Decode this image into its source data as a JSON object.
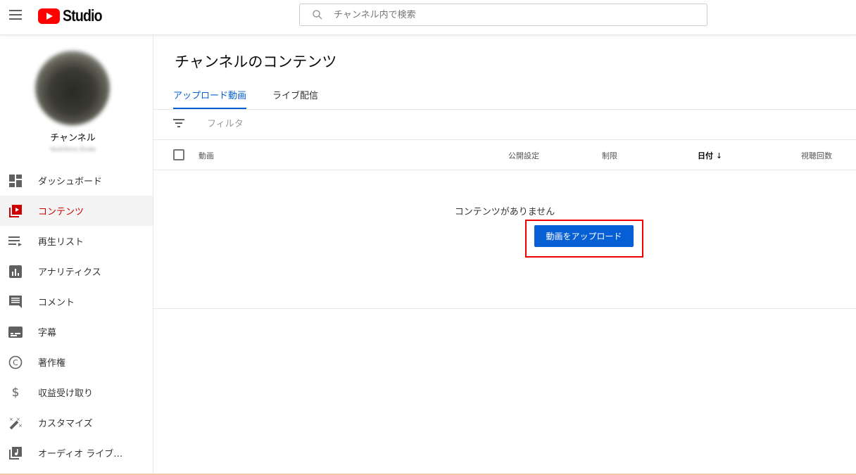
{
  "header": {
    "logo_text": "Studio",
    "search_placeholder": "チャンネル内で検索"
  },
  "channel": {
    "name": "チャンネル",
    "handle": "Yoshihiro Endo"
  },
  "sidebar": {
    "items": [
      {
        "label": "ダッシュボード",
        "icon": "dashboard-icon"
      },
      {
        "label": "コンテンツ",
        "icon": "content-icon",
        "active": true
      },
      {
        "label": "再生リスト",
        "icon": "playlist-icon"
      },
      {
        "label": "アナリティクス",
        "icon": "analytics-icon"
      },
      {
        "label": "コメント",
        "icon": "comment-icon"
      },
      {
        "label": "字幕",
        "icon": "subtitles-icon"
      },
      {
        "label": "著作権",
        "icon": "copyright-icon"
      },
      {
        "label": "収益受け取り",
        "icon": "dollar-icon"
      },
      {
        "label": "カスタマイズ",
        "icon": "magic-wand-icon"
      },
      {
        "label": "オーディオ ライブ…",
        "icon": "audio-library-icon"
      }
    ]
  },
  "main": {
    "title": "チャンネルのコンテンツ",
    "tabs": [
      {
        "label": "アップロード動画",
        "active": true
      },
      {
        "label": "ライブ配信"
      }
    ],
    "filter_label": "フィルタ",
    "columns": [
      "動画",
      "公開設定",
      "制限",
      "日付",
      "視聴回数"
    ],
    "empty_text": "コンテンツがありません",
    "upload_button": "動画をアップロード"
  },
  "colors": {
    "accent": "#065fd4",
    "brand": "#ff0000",
    "highlight": "#ee0000"
  }
}
